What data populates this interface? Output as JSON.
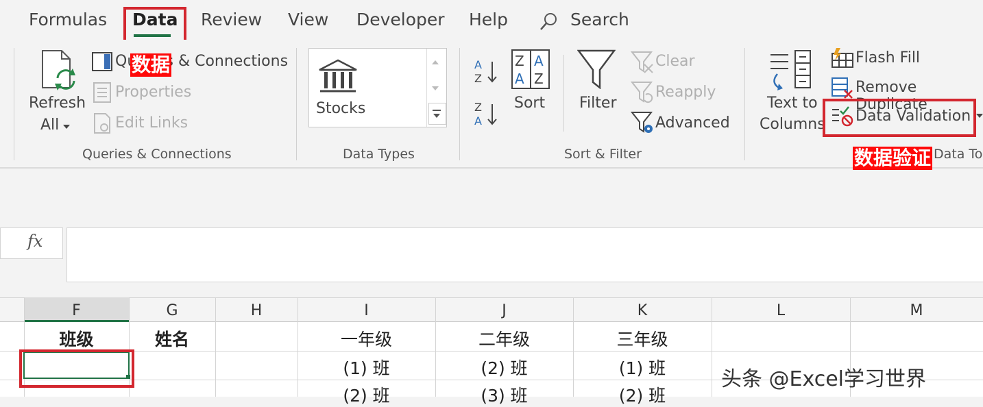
{
  "tabs": [
    "Formulas",
    "Data",
    "Review",
    "View",
    "Developer",
    "Help"
  ],
  "search_label": "Search",
  "annotations": {
    "data_cn": "数据",
    "validation_cn": "数据验证"
  },
  "queries": {
    "refresh_line1": "Refresh",
    "refresh_line2": "All",
    "queries_connections": "Queries & Connections",
    "properties": "Properties",
    "edit_links": "Edit Links",
    "group_label": "Queries & Connections"
  },
  "data_types": {
    "stocks": "Stocks",
    "group_label": "Data Types"
  },
  "sort_filter": {
    "sort": "Sort",
    "filter": "Filter",
    "clear": "Clear",
    "reapply": "Reapply",
    "advanced": "Advanced",
    "group_label": "Sort & Filter"
  },
  "data_tools": {
    "text_to_line1": "Text to",
    "text_to_line2": "Columns",
    "flash_fill": "Flash Fill",
    "remove_duplicates": "Remove Duplicate",
    "data_validation": "Data Validation",
    "group_label": "Data To"
  },
  "formula_bar": {
    "fx": "fx",
    "value": ""
  },
  "columns": [
    "F",
    "G",
    "H",
    "I",
    "J",
    "K",
    "L",
    "M"
  ],
  "rows": [
    [
      "班级",
      "姓名",
      "",
      "一年级",
      "二年级",
      "三年级",
      "",
      ""
    ],
    [
      "",
      "",
      "",
      "(1) 班",
      "(2) 班",
      "(1) 班",
      "",
      ""
    ],
    [
      "",
      "",
      "",
      "(2) 班",
      "(3) 班",
      "(2) 班",
      "",
      ""
    ]
  ],
  "watermark": "头条 @Excel学习世界"
}
